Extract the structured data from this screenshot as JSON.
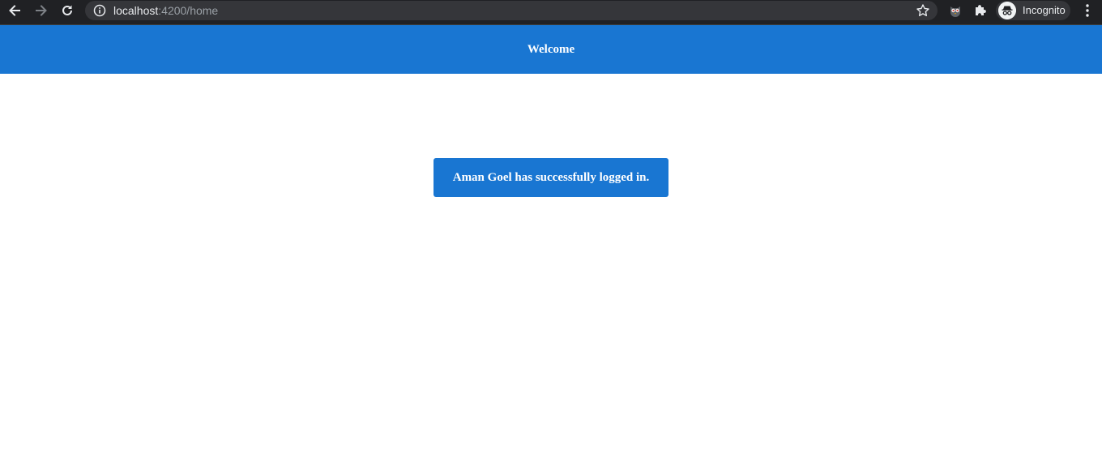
{
  "browser": {
    "url_host": "localhost",
    "url_rest": ":4200/home",
    "profile_label": "Incognito"
  },
  "header": {
    "title": "Welcome"
  },
  "main": {
    "message": "Aman Goel has successfully logged in."
  },
  "colors": {
    "brand": "#1976d2",
    "browser_bar": "#202124",
    "omnibox": "#35363a"
  }
}
